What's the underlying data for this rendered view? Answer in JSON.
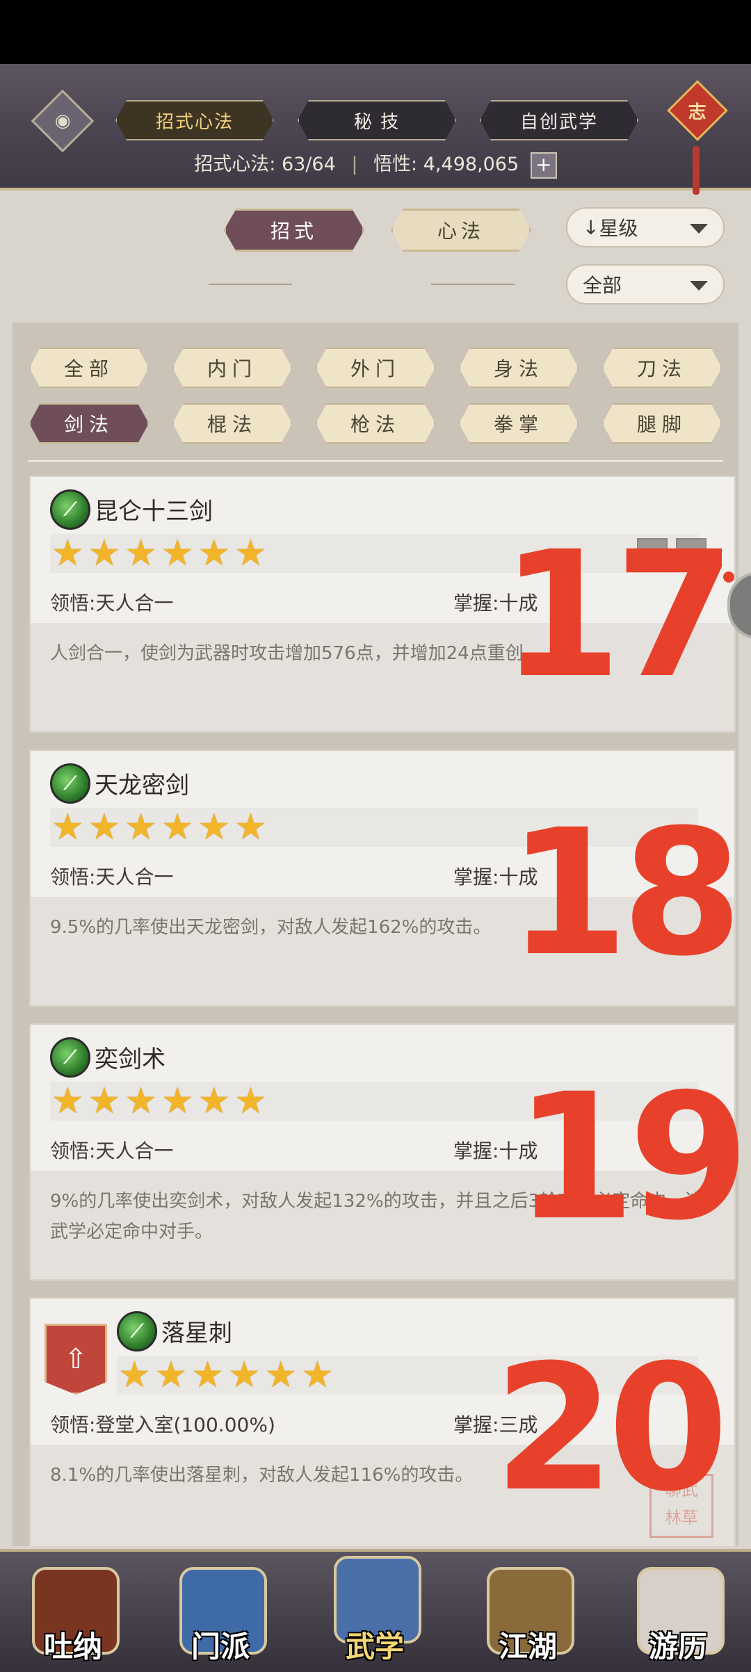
{
  "header": {
    "tabs": [
      {
        "label": "招式心法",
        "active": true
      },
      {
        "label": "秘 技",
        "active": false
      },
      {
        "label": "自创武学",
        "active": false
      }
    ],
    "knot_label": "志",
    "stats": {
      "moves_label": "招式心法:",
      "moves_value": "63/64",
      "insight_label": "悟性:",
      "insight_value": "4,498,065",
      "plus": "+"
    }
  },
  "subtabs": [
    {
      "label": "招式",
      "active": true
    },
    {
      "label": "心法",
      "active": false
    }
  ],
  "sort_dropdown": {
    "icon": "↓",
    "value": "星级"
  },
  "filter_dropdown": {
    "value": "全部"
  },
  "categories": [
    {
      "label": "全部",
      "active": false
    },
    {
      "label": "内门",
      "active": false
    },
    {
      "label": "外门",
      "active": false
    },
    {
      "label": "身法",
      "active": false
    },
    {
      "label": "刀法",
      "active": false
    },
    {
      "label": "剑法",
      "active": true
    },
    {
      "label": "棍法",
      "active": false
    },
    {
      "label": "枪法",
      "active": false
    },
    {
      "label": "拳掌",
      "active": false
    },
    {
      "label": "腿脚",
      "active": false
    }
  ],
  "skills": [
    {
      "name": "昆仑十三剑",
      "stars": 6,
      "comprehension_label": "领悟:",
      "comprehension": "天人合一",
      "mastery_label": "掌握:",
      "mastery": "十成",
      "description": "人剑合一，使剑为武器时攻击增加576点，并增加24点重创。"
    },
    {
      "name": "天龙密剑",
      "stars": 6,
      "comprehension_label": "领悟:",
      "comprehension": "天人合一",
      "mastery_label": "掌握:",
      "mastery": "十成",
      "description": "9.5%的几率使出天龙密剑，对敌人发起162%的攻击。"
    },
    {
      "name": "奕剑术",
      "stars": 6,
      "comprehension_label": "领悟:",
      "comprehension": "天人合一",
      "mastery_label": "掌握:",
      "mastery": "十成",
      "description": "9%的几率使出奕剑术，对敌人发起132%的攻击，并且之后3轮攻击必定命中。该武学必定命中对手。"
    },
    {
      "name": "落星刺",
      "stars": 6,
      "comprehension_label": "领悟:",
      "comprehension": "登堂入室(100.00%)",
      "mastery_label": "掌握:",
      "mastery": "三成",
      "description": "8.1%的几率使出落星刺，对敌人发起116%的攻击。"
    }
  ],
  "annotations": [
    "17",
    "18",
    "19",
    "20"
  ],
  "seal_text": "聊武\n林草",
  "bottom_nav": [
    {
      "label": "吐纳",
      "active": false,
      "color": "#7a3520"
    },
    {
      "label": "门派",
      "active": false,
      "color": "#3f6aa8"
    },
    {
      "label": "武学",
      "active": true,
      "color": "#4a6fa8"
    },
    {
      "label": "江湖",
      "active": false,
      "color": "#8a6a3a"
    },
    {
      "label": "游历",
      "active": false,
      "color": "#d8d0c8"
    }
  ]
}
